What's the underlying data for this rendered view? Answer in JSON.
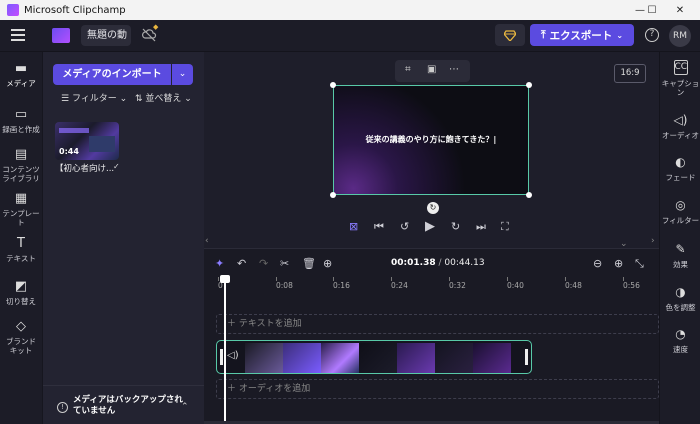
{
  "window": {
    "title": "Microsoft Clipchamp",
    "minimize": "—",
    "maximize": "☐",
    "close": "✕"
  },
  "header": {
    "project_name": "無題の動",
    "export_label": "エクスポート",
    "avatar": "RM"
  },
  "leftnav": [
    {
      "label": "メディア",
      "icon": "▭"
    },
    {
      "label": "録画と作成",
      "icon": "▭"
    },
    {
      "label": "コンテンツ ライブラリ",
      "icon": "▤"
    },
    {
      "label": "テンプレート",
      "icon": "▦"
    },
    {
      "label": "テキスト",
      "icon": "T"
    },
    {
      "label": "切り替え",
      "icon": "◩"
    },
    {
      "label": "ブランドキット",
      "icon": "◇"
    }
  ],
  "media": {
    "import_label": "メディアのインポート",
    "filter_label": "フィルター",
    "sort_label": "並べ替え",
    "item": {
      "duration": "0:44",
      "name": "【初心者向け..."
    },
    "backup_text": "メディアはバックアップされていません"
  },
  "preview": {
    "aspect": "16:9",
    "caption": "従来の講義のやり方に飽きてきた？|"
  },
  "rightpanel": [
    {
      "label": "キャプション",
      "icon": "CC"
    },
    {
      "label": "オーディオ",
      "icon": "🔈"
    },
    {
      "label": "フェード",
      "icon": "◐"
    },
    {
      "label": "フィルター",
      "icon": "◎"
    },
    {
      "label": "効果",
      "icon": "✎"
    },
    {
      "label": "色を調整",
      "icon": "◑"
    },
    {
      "label": "速度",
      "icon": "◔"
    }
  ],
  "timeline": {
    "current": "00:01.38",
    "total": "00:44.13",
    "ticks": [
      "0",
      "0:08",
      "0:16",
      "0:24",
      "0:32",
      "0:40",
      "0:48",
      "0:56"
    ],
    "text_track": "＋ テキストを追加",
    "audio_track": "＋ オーディオを追加"
  }
}
